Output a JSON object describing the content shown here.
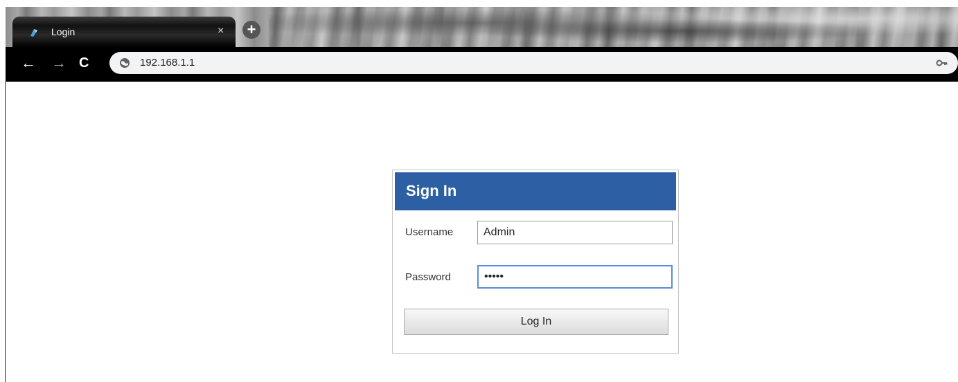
{
  "browser": {
    "tab_title": "Login",
    "tab_close": "×",
    "new_tab": "+",
    "back": "←",
    "forward": "→",
    "reload": "C",
    "url": "192.168.1.1",
    "icons": [
      "tab-favicon-icon",
      "globe-icon",
      "key-icon"
    ]
  },
  "login": {
    "title": "Sign In",
    "username_label": "Username",
    "username_value": "Admin",
    "password_label": "Password",
    "password_value": "•••••",
    "submit_label": "Log In"
  },
  "colors": {
    "header_blue": "#2c5fa3",
    "focus_border": "#5b8dd9"
  }
}
